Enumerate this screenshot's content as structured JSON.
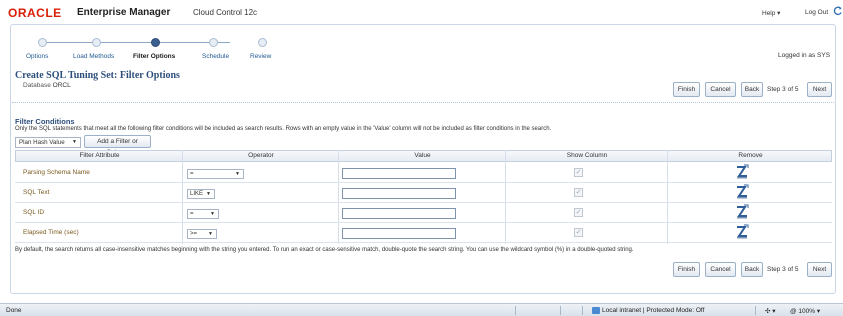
{
  "header": {
    "brand": "ORACLE",
    "product": "Enterprise Manager",
    "edition": "Cloud Control 12c",
    "help_label": "Help ▾",
    "logout_label": "Log Out",
    "refresh_icon": "refresh-icon"
  },
  "train": {
    "steps": [
      {
        "label": "Options",
        "active": false
      },
      {
        "label": "Load Methods",
        "active": false
      },
      {
        "label": "Filter Options",
        "active": true
      },
      {
        "label": "Schedule",
        "active": false
      },
      {
        "label": "Review",
        "active": false
      }
    ]
  },
  "logged_in": "Logged in as SYS",
  "page": {
    "title": "Create SQL Tuning Set: Filter Options",
    "db_label": "Database",
    "db_value": "ORCL"
  },
  "nav": {
    "finish": "Finish",
    "cancel": "Cancel",
    "back": "Back",
    "step_text": "Step 3 of 5",
    "next": "Next"
  },
  "filter": {
    "section_title": "Filter Conditions",
    "description": "Only the SQL statements that meet all the following filter conditions will be included as search results. Rows with an empty value in the 'Value' column will not be included as filter conditions in the search.",
    "add_select_value": "Plan Hash Value",
    "add_button": "Add a Filter or Column",
    "columns": [
      "Filter Attribute",
      "Operator",
      "Value",
      "Show Column",
      "Remove"
    ],
    "rows": [
      {
        "attribute": "Parsing Schema Name",
        "operator": "=",
        "value": "",
        "show_column": true
      },
      {
        "attribute": "SQL Text",
        "operator": "LIKE",
        "value": "",
        "show_column": true
      },
      {
        "attribute": "SQL ID",
        "operator": "=",
        "value": "",
        "show_column": true
      },
      {
        "attribute": "Elapsed Time (sec)",
        "operator": ">=",
        "value": "",
        "show_column": true
      }
    ],
    "search_note": "By default, the search returns all case-insensitive matches beginning with the string you entered. To run an exact or case-sensitive match, double-quote the search string. You can use the wildcard symbol (%) in a double-quoted string."
  },
  "statusbar": {
    "done": "Done",
    "zone": "Local intranet | Protected Mode: Off",
    "zoom_tool": "✣ ▾",
    "zoom": "@ 100%  ▾"
  },
  "colors": {
    "brand_red": "#d81e05",
    "title_blue": "#2d4f7c",
    "link_brown": "#7a5a1e"
  }
}
